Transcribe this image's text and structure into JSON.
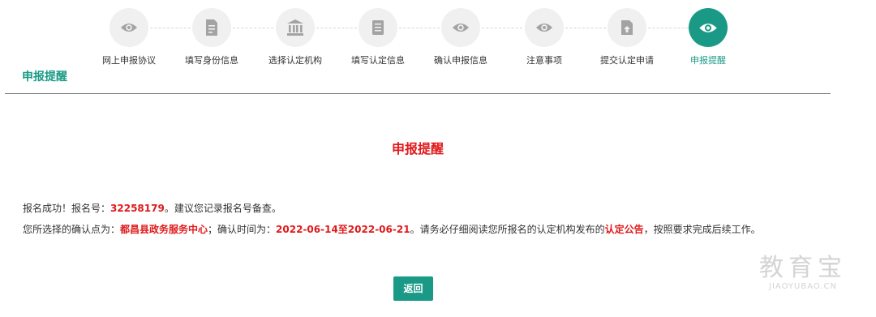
{
  "steps": [
    {
      "label": "网上申报协议",
      "icon": "eye-icon"
    },
    {
      "label": "填写身份信息",
      "icon": "document-icon"
    },
    {
      "label": "选择认定机构",
      "icon": "bank-icon"
    },
    {
      "label": "填写认定信息",
      "icon": "file-icon"
    },
    {
      "label": "确认申报信息",
      "icon": "eye-icon"
    },
    {
      "label": "注意事项",
      "icon": "eye-icon"
    },
    {
      "label": "提交认定申请",
      "icon": "submit-icon"
    },
    {
      "label": "申报提醒",
      "icon": "eye-icon",
      "active": true
    }
  ],
  "section_title": "申报提醒",
  "notice": {
    "title": "申报提醒",
    "line1_prefix": "报名成功！报名号：",
    "registration_number": "32258179",
    "line1_suffix": "。建议您记录报名号备查。",
    "line2_prefix": "您所选择的确认点为：",
    "confirmation_point": "都昌县政务服务中心",
    "line2_mid": "；确认时间为：",
    "confirmation_period": "2022-06-14至2022-06-21",
    "line2_mid2": "。请务必仔细阅读您所报名的认定机构发布的",
    "announcement": "认定公告",
    "line2_suffix": "，按照要求完成后续工作。"
  },
  "back_label": "返回",
  "watermark": {
    "main": "教育宝",
    "sub": "JIAOYUBAO.CN"
  },
  "colors": {
    "accent": "#1a9a86",
    "highlight": "#e0191a",
    "inactive_circle": "#f0f0f0",
    "inactive_icon": "#a3a3a3"
  }
}
